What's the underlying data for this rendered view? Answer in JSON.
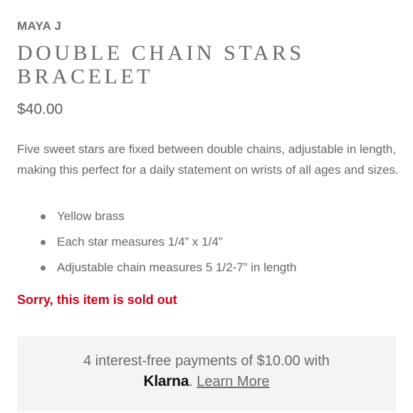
{
  "product": {
    "brand": "MAYA J",
    "title": "DOUBLE CHAIN STARS BRACELET",
    "price": "$40.00",
    "description": "Five sweet stars are fixed between double chains, adjustable in length, making this perfect for a daily statement on wrists of all ages and sizes.",
    "features": [
      "Yellow brass",
      "Each star measures 1/4” x 1/4”",
      "Adjustable chain measures 5 1/2-7” in length"
    ],
    "availability": "Sorry, this item is sold out"
  },
  "klarna": {
    "line1": "4 interest-free payments of $10.00 with",
    "logo_text": "Klarna",
    "separator": ".",
    "link_text": "Learn More"
  },
  "colors": {
    "sold_out": "#d0021b",
    "text": "#666666",
    "klarna_bg": "#f4f4f4"
  }
}
